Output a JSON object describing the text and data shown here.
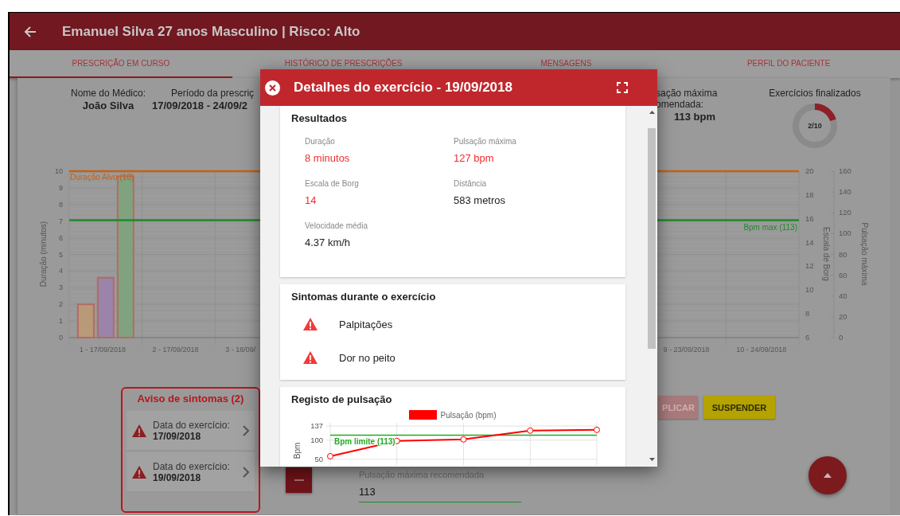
{
  "header": {
    "title": "Emanuel Silva 27 anos Masculino | Risco: Alto"
  },
  "tabs": [
    {
      "label": "PRESCRIÇÃO EM CURSO",
      "selected": true
    },
    {
      "label": "HISTÓRICO DE PRESCRIÇÕES",
      "selected": false
    },
    {
      "label": "MENSAGENS",
      "selected": false
    },
    {
      "label": "PERFIL DO PACIENTE",
      "selected": false
    }
  ],
  "doctor": {
    "label": "Nome do Médico:",
    "value": "João Silva"
  },
  "period": {
    "label": "Período da prescriç",
    "value": "17/09/2018 - 24/09/2"
  },
  "max_pulse": {
    "lines": [
      "sação máxima",
      "omendada:"
    ],
    "value": "113 bpm"
  },
  "finished": {
    "label": "Exercícios finalizados",
    "count": "2/10"
  },
  "history_chart": {
    "chart_data": {
      "type": "bar",
      "ylabel": "Duração (minutos)",
      "categories": [
        "1 - 17/09/2018",
        "2 - 17/09/2018",
        "3 - 18/09/",
        null,
        null,
        null,
        null,
        null,
        "9 - 23/09/2018",
        "10 - 24/09/2018"
      ],
      "series": [
        {
          "color": "#b89a78",
          "values": [
            2,
            null,
            null,
            null,
            null,
            null,
            null,
            null,
            null,
            null
          ]
        },
        {
          "color": "#9a84aa",
          "values": [
            3.6,
            null,
            null,
            null,
            null,
            null,
            null,
            null,
            null,
            null
          ]
        },
        {
          "color": "#80a27f",
          "values": [
            9.7,
            null,
            null,
            null,
            null,
            null,
            null,
            null,
            null,
            null
          ]
        }
      ],
      "ylim": [
        0,
        10
      ],
      "yticks": [
        0,
        1,
        2,
        3,
        4,
        5,
        6,
        7,
        8,
        9,
        10
      ],
      "grid": true,
      "ref_lines": [
        {
          "axis": "y",
          "value": 10,
          "label": "Duração Alvo (10)",
          "color": "#c8600f"
        },
        {
          "axis": "y",
          "value": 7.06,
          "label": "Bpm max (113)",
          "color": "#1f8a2a"
        }
      ]
    },
    "right_axes": [
      {
        "kind": "borg",
        "label": "Escala de Borg",
        "ticks": [
          "20",
          "18",
          "16",
          "14",
          "12",
          "10",
          "8",
          "6"
        ]
      },
      {
        "kind": "pulse",
        "label": "Pulsação máxima",
        "ticks": [
          "160",
          "140",
          "120",
          "100",
          "80",
          "60",
          "40",
          "20",
          "0"
        ]
      }
    ]
  },
  "symptom_alerts": {
    "title": "Aviso de sintomas (2)",
    "items": [
      {
        "label": "Data do exercício:",
        "date": "17/09/2018"
      },
      {
        "label": "Data do exercício:",
        "date": "19/09/2018"
      }
    ]
  },
  "actions": [
    {
      "label": "PLICAR",
      "kind": "apply"
    },
    {
      "label": "SUSPENDER",
      "kind": "suspend"
    }
  ],
  "max_pulse_field": {
    "label": "Pulsação máxima recomendada",
    "value": "113"
  },
  "modal": {
    "title": "Detalhes do exercício - 19/09/2018",
    "results": {
      "title": "Resultados",
      "fields": [
        {
          "label": "Duração",
          "value": "8 minutos",
          "highlight": true
        },
        {
          "label": "Pulsação máxima",
          "value": "127 bpm",
          "highlight": true
        },
        {
          "label": "Escala de Borg",
          "value": "14",
          "highlight": true
        },
        {
          "label": "Distância",
          "value": "583 metros",
          "highlight": false
        },
        {
          "label": "Velocidade média",
          "value": "4.37 km/h",
          "highlight": false
        }
      ]
    },
    "symptoms": {
      "title": "Sintomas durante o exercício",
      "items": [
        "Palpitações",
        "Dor no peito"
      ]
    },
    "pulse": {
      "title": "Registo de pulsação",
      "chart_data": {
        "type": "line",
        "ylabel": "Bpm",
        "yticks": [
          50,
          100,
          137
        ],
        "ylim": [
          35,
          137
        ],
        "categories": [
          null,
          null,
          null,
          null,
          null
        ],
        "grid": true,
        "series": [
          {
            "name": "Pulsação (bpm)",
            "color": "#ff0000",
            "marker": "o",
            "values": [
              58,
              98,
              102,
              125,
              127
            ]
          }
        ],
        "ref_lines": [
          {
            "axis": "y",
            "value": 113,
            "label": "Bpm limite (113)",
            "color": "#22aa22"
          }
        ]
      }
    }
  }
}
